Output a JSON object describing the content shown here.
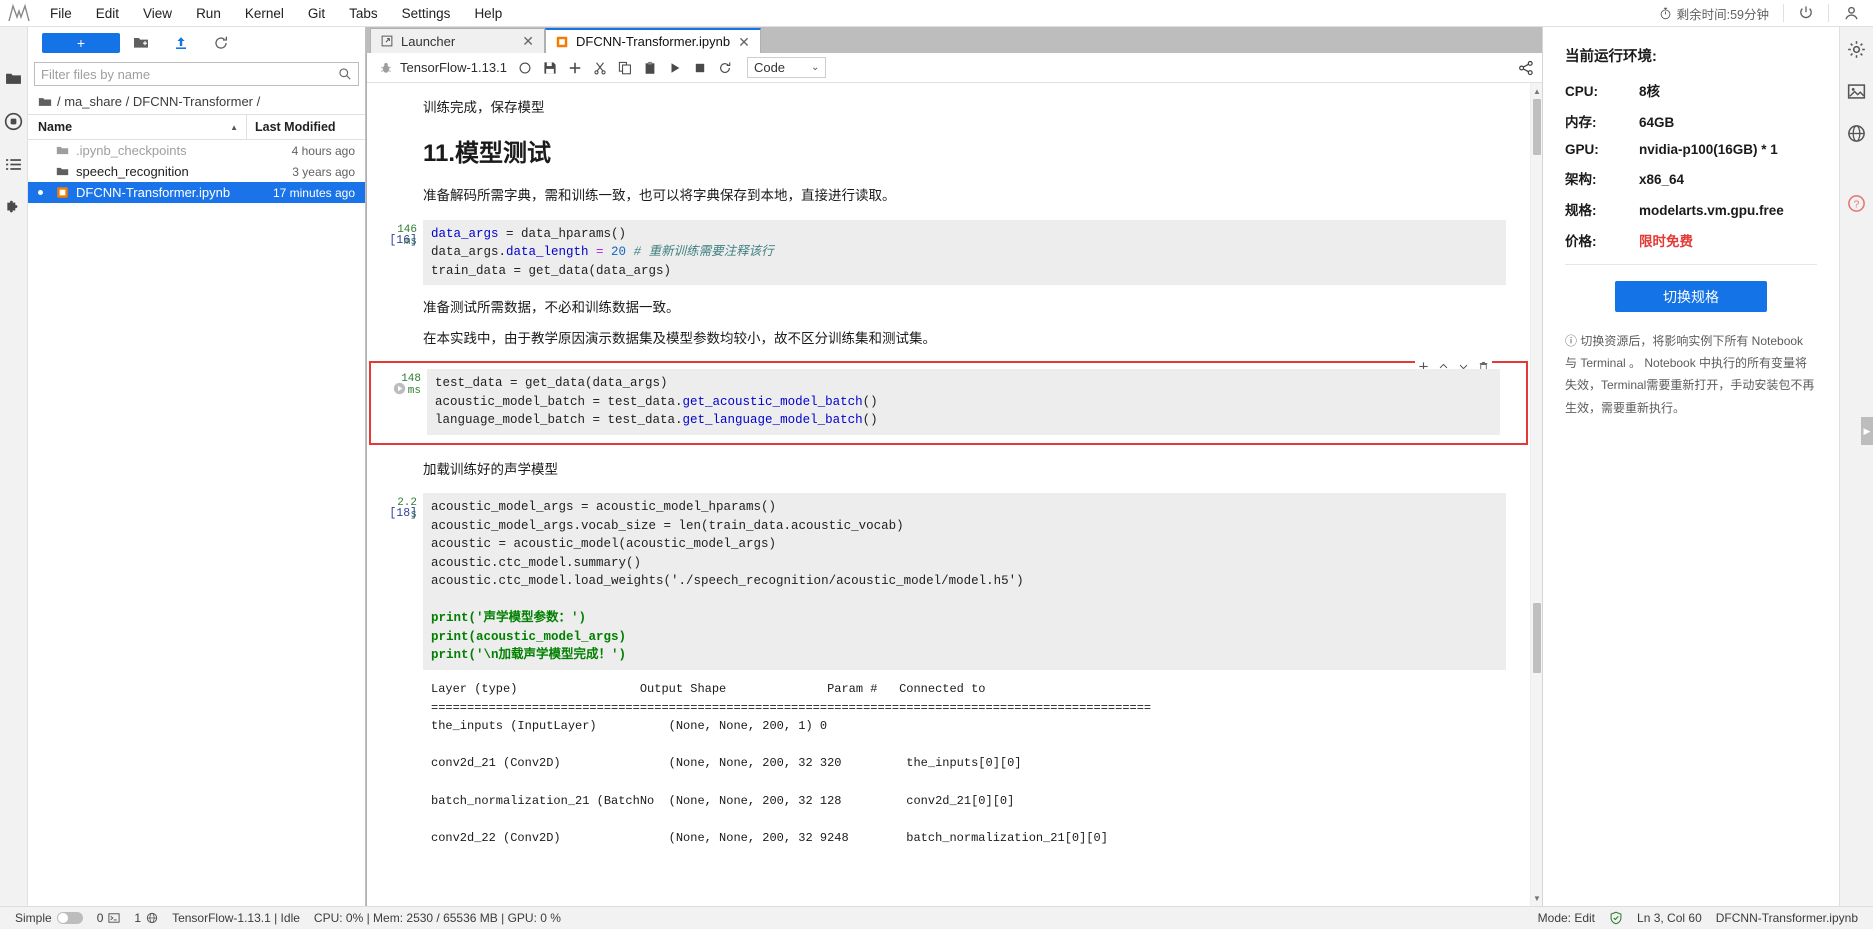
{
  "menubar": {
    "logo": "jupyter-logo-icon",
    "items": [
      "File",
      "Edit",
      "View",
      "Run",
      "Kernel",
      "Git",
      "Tabs",
      "Settings",
      "Help"
    ],
    "timer_label": "剩余时间:59分钟",
    "power_icon": "power-icon",
    "user_icon": "user-icon"
  },
  "filebrowser": {
    "new_button": "+",
    "toolbar_icons": [
      "folder-icon",
      "new-folder-icon",
      "upload-icon",
      "refresh-icon"
    ],
    "filter_placeholder": "Filter files by name",
    "filter_value": "",
    "breadcrumb": "/ ma_share / DFCNN-Transformer /",
    "columns": [
      "Name",
      "Last Modified"
    ],
    "sort_indicator": "▲",
    "rows": [
      {
        "name": ".ipynb_checkpoints",
        "modified": "4 hours ago",
        "icon": "folder-icon",
        "dim": true,
        "selected": false
      },
      {
        "name": "speech_recognition",
        "modified": "3 years ago",
        "icon": "folder-icon",
        "dim": false,
        "selected": false
      },
      {
        "name": "DFCNN-Transformer.ipynb",
        "modified": "17 minutes ago",
        "icon": "notebook-icon",
        "dim": false,
        "selected": true
      }
    ]
  },
  "tabs": [
    {
      "label": "Launcher",
      "icon": "launcher-icon",
      "active": false
    },
    {
      "label": "DFCNN-Transformer.ipynb",
      "icon": "notebook-icon",
      "active": true
    }
  ],
  "notebook_toolbar": {
    "kernel_name": "TensorFlow-1.13.1",
    "icons": [
      "bug-icon",
      "kernel-status-icon",
      "save-icon",
      "add-cell-icon",
      "cut-icon",
      "copy-icon",
      "paste-icon",
      "run-icon",
      "stop-icon",
      "restart-icon"
    ],
    "celltype": "Code",
    "celltype_caret": "⌄",
    "share_icon": "share-icon"
  },
  "notebook": {
    "md_note_1": "训练完成，保存模型",
    "heading": "11.模型测试",
    "md_note_2": "准备解码所需字典，需和训练一致，也可以将字典保存到本地，直接进行读取。",
    "cell16": {
      "timing": "146 ms",
      "timing_num": "146",
      "timing_unit": "ms",
      "prompt": "[16]",
      "line1_a": "data_args",
      "line1_b": " = data_hparams()",
      "line2_a": "data_args.",
      "line2_b": "data_length",
      "line2_c": " = ",
      "line2_d": "20",
      "line2_comment": "# 重新训练需要注释该行",
      "line3": "train_data = get_data(data_args)"
    },
    "md_note_3": "准备测试所需数据，不必和训练数据一致。",
    "md_note_4": "在本实践中，由于教学原因演示数据集及模型参数均较小，故不区分训练集和测试集。",
    "cell_selected": {
      "timing_num": "148",
      "timing_unit": "ms",
      "line1": "test_data = get_data(data_args)",
      "line2_a": "acoustic_model_batch = test_data.",
      "line2_b": "get_acoustic_model_batch",
      "line2_c": "()",
      "line3_a": "language_model_batch = test_data.",
      "line3_b": "get_language_model_batch",
      "line3_c": "()",
      "tools": [
        "add-cell-icon",
        "move-up-icon",
        "move-down-icon",
        "delete-cell-icon"
      ],
      "run_icon": "run-cell-icon"
    },
    "md_note_5": "加载训练好的声学模型",
    "cell18": {
      "timing_num": "2.2",
      "timing_unit": "s",
      "prompt": "[18]",
      "lines": [
        "acoustic_model_args = acoustic_model_hparams()",
        "acoustic_model_args.vocab_size = len(train_data.acoustic_vocab)",
        "acoustic = acoustic_model(acoustic_model_args)",
        "acoustic.ctc_model.summary()",
        "acoustic.ctc_model.load_weights('./speech_recognition/acoustic_model/model.h5')",
        "",
        "print('声学模型参数：')",
        "print(acoustic_model_args)",
        "print('\\n加载声学模型完成！')"
      ]
    },
    "output_table": {
      "header": "Layer (type)                 Output Shape              Param #   Connected to",
      "sep1": "====================================================================================================",
      "rows": [
        "the_inputs (InputLayer)          (None, None, 200, 1) 0",
        "conv2d_21 (Conv2D)               (None, None, 200, 32 320         the_inputs[0][0]",
        "batch_normalization_21 (BatchNo  (None, None, 200, 32 128         conv2d_21[0][0]",
        "conv2d_22 (Conv2D)               (None, None, 200, 32 9248        batch_normalization_21[0][0]"
      ]
    }
  },
  "rightpanel": {
    "title": "当前运行环境:",
    "specs": [
      {
        "key": "CPU:",
        "value": "8核",
        "highlight": false
      },
      {
        "key": "内存:",
        "value": "64GB",
        "highlight": false
      },
      {
        "key": "GPU:",
        "value": "nvidia-p100(16GB) * 1",
        "highlight": false
      },
      {
        "key": "架构:",
        "value": "x86_64",
        "highlight": false
      },
      {
        "key": "规格:",
        "value": "modelarts.vm.gpu.free",
        "highlight": false
      },
      {
        "key": "价格:",
        "value": "限时免费",
        "highlight": true
      }
    ],
    "switch_button": "切换规格",
    "note": "ⓘ 切换资源后，将影响实例下所有 Notebook 与 Terminal 。 Notebook 中执行的所有变量将失效，Terminal需要重新打开，手动安装包不再生效，需要重新执行。"
  },
  "right_rail": {
    "icons": [
      "settings-gear-icon",
      "image-icon",
      "globe-icon",
      "help-icon"
    ]
  },
  "statusbar": {
    "mode_label": "Simple",
    "toggle_state": "off",
    "terminal_count": "0",
    "kernel_count": "1",
    "globe_icon": "globe-icon",
    "kernel_status": "TensorFlow-1.13.1 | Idle",
    "resources": "CPU: 0% | Mem: 2530 / 65536 MB | GPU: 0 %",
    "mode": "Mode: Edit",
    "shield_icon": "shield-icon",
    "cursor": "Ln 3, Col 60",
    "filename": "DFCNN-Transformer.ipynb"
  },
  "colors": {
    "accent": "#1473e6",
    "selected_row": "#1a73e8",
    "highlight_border": "#e53935",
    "free_price": "#e53935"
  }
}
